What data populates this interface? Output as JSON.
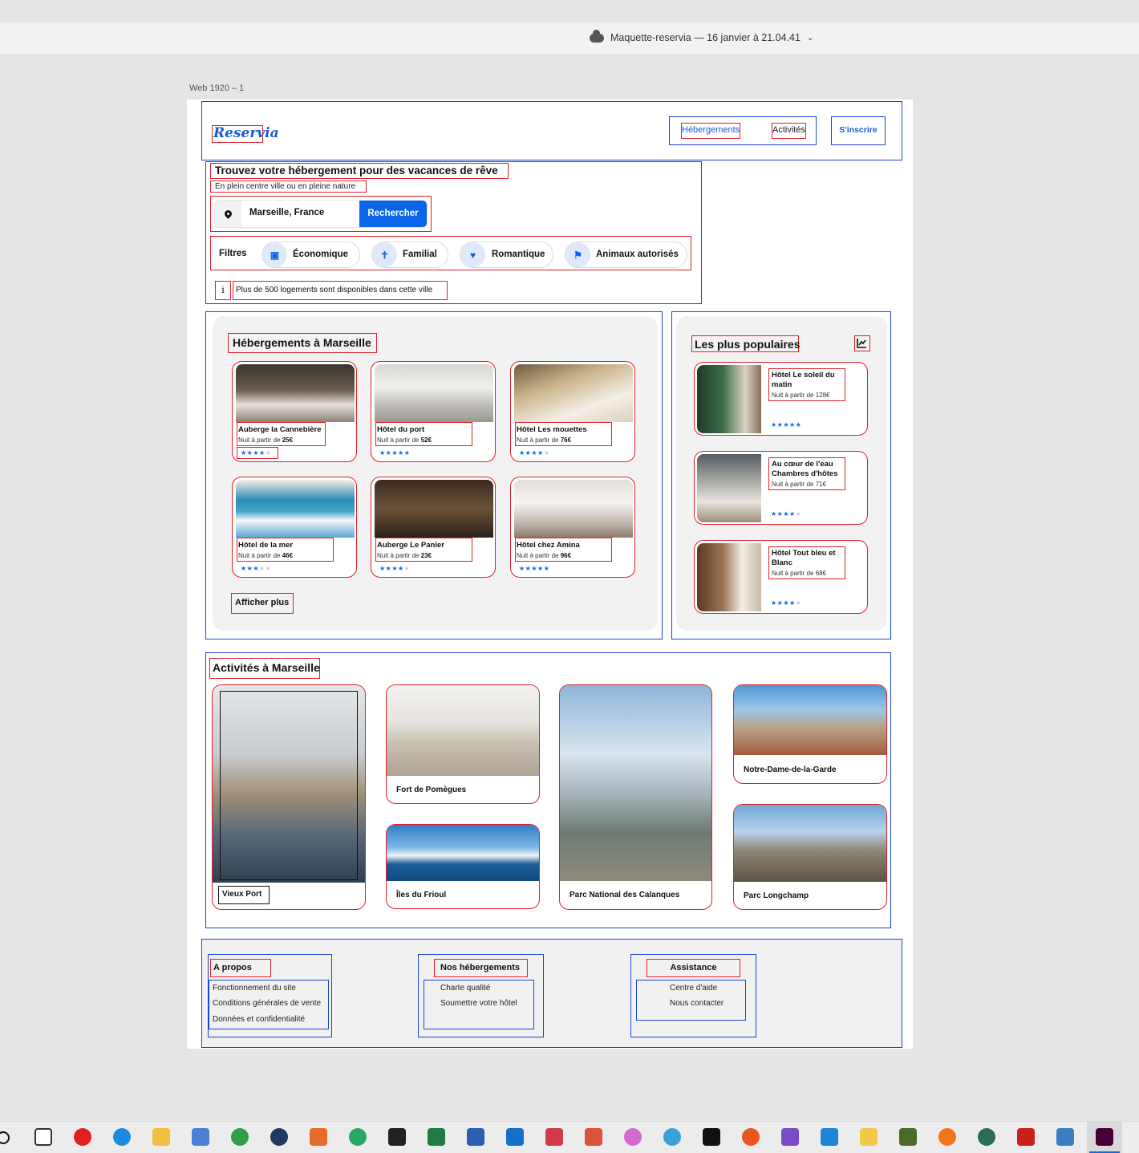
{
  "window": {
    "title": "Maquette-reservia — 16 janvier à 21.04.41",
    "artboard_label": "Web 1920 – 1"
  },
  "header": {
    "logo": "Reservia",
    "nav": [
      "Hébergements",
      "Activités"
    ],
    "signup": "S'inscrire"
  },
  "hero": {
    "title": "Trouvez votre hébergement pour des vacances de rêve",
    "subtitle": "En plein centre ville ou en pleine nature",
    "search_value": "Marseille, France",
    "search_button": "Rechercher",
    "filters_label": "Filtres",
    "filters": [
      {
        "label": "Économique",
        "icon": "money-icon"
      },
      {
        "label": "Familial",
        "icon": "family-icon"
      },
      {
        "label": "Romantique",
        "icon": "heart-icon"
      },
      {
        "label": "Animaux autorisés",
        "icon": "dog-icon"
      }
    ],
    "info_icon": "i",
    "info_text": "Plus de 500 logements sont disponibles dans cette ville"
  },
  "hebergements": {
    "title": "Hébergements à Marseille",
    "price_prefix": "Nuit à partir de ",
    "items": [
      {
        "name": "Auberge la Cannebière",
        "price": "25€",
        "stars": 4
      },
      {
        "name": "Hôtel du port",
        "price": "52€",
        "stars": 5
      },
      {
        "name": "Hôtel Les mouettes",
        "price": "76€",
        "stars": 4
      },
      {
        "name": "Hôtel de la mer",
        "price": "46€",
        "stars": 3
      },
      {
        "name": "Auberge Le Panier",
        "price": "23€",
        "stars": 4
      },
      {
        "name": "Hôtel chez Amina",
        "price": "96€",
        "stars": 5
      }
    ],
    "more_button": "Afficher plus"
  },
  "populaires": {
    "title": "Les plus populaires",
    "icon": "trend-icon",
    "items": [
      {
        "name": "Hôtel Le soleil du matin",
        "price": "Nuit à partir de 128€",
        "stars": 5
      },
      {
        "name": "Au cœur de l'eau Chambres d'hôtes",
        "price": "Nuit à partir de 71€",
        "stars": 4
      },
      {
        "name": "Hôtel Tout bleu et Blanc",
        "price": "Nuit à partir de 68€",
        "stars": 4
      }
    ]
  },
  "activites": {
    "title": "Activités à Marseille",
    "items": [
      "Vieux Port",
      "Fort de Pomègues",
      "Îles du Frioul",
      "Parc National des Calanques",
      "Notre-Dame-de-la-Garde",
      "Parc Longchamp"
    ]
  },
  "footer": {
    "columns": [
      {
        "title": "A propos",
        "links": [
          "Fonctionnement du site",
          "Conditions générales de vente",
          "Données et confidentialité"
        ]
      },
      {
        "title": "Nos hébergements",
        "links": [
          "Charte qualité",
          "Soumettre votre hôtel"
        ]
      },
      {
        "title": "Assistance",
        "links": [
          "Centre d'aide",
          "Nous contacter"
        ]
      }
    ]
  },
  "colors": {
    "brand_blue": "#0b65e8",
    "annotation_red": "#e0202a",
    "annotation_blue": "#1a44d6"
  }
}
